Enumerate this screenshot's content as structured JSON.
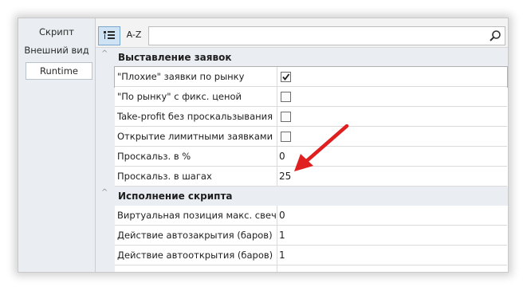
{
  "sidebar": {
    "items": [
      "Скрипт",
      "Внешний вид",
      "Runtime"
    ]
  },
  "toolbar": {
    "az_label": "A-Z",
    "search_value": ""
  },
  "sections": [
    {
      "title": "Выставление заявок",
      "rows": [
        {
          "name": "\"Плохие\" заявки по рынку",
          "type": "checkbox",
          "checked": true
        },
        {
          "name": "\"По рынку\" с фикс. ценой",
          "type": "checkbox",
          "checked": false
        },
        {
          "name": "Take-profit без проскальзывания",
          "type": "checkbox",
          "checked": false
        },
        {
          "name": "Открытие лимитными заявками",
          "type": "checkbox",
          "checked": false
        },
        {
          "name": "Проскальз. в %",
          "type": "value",
          "value": "0"
        },
        {
          "name": "Проскальз. в шагах",
          "type": "value",
          "value": "25"
        }
      ]
    },
    {
      "title": "Исполнение скрипта",
      "rows": [
        {
          "name": "Виртуальная позиция макс. свечей",
          "type": "value",
          "value": "0"
        },
        {
          "name": "Действие автозакрытия (баров)",
          "type": "value",
          "value": "1"
        },
        {
          "name": "Действие автооткрытия (баров)",
          "type": "value",
          "value": "1"
        }
      ]
    }
  ],
  "colors": {
    "selected_tab_bg": "#cfe3f5",
    "annotation_arrow": "#e02020"
  }
}
